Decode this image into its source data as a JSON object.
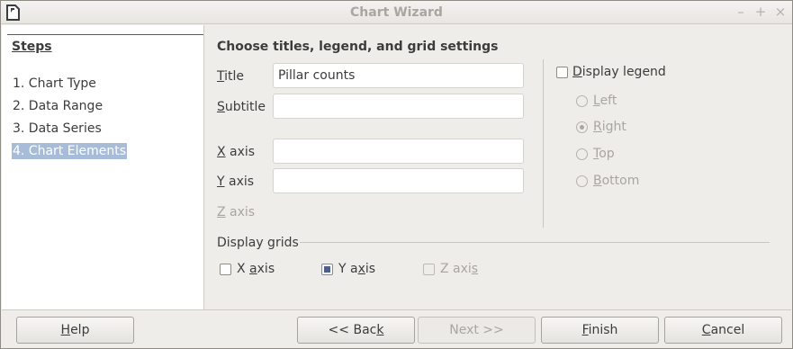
{
  "window": {
    "title": "Chart Wizard"
  },
  "wm": {
    "minimize": "–",
    "maximize": "+",
    "close": "×"
  },
  "steps": {
    "title": "Steps",
    "items": [
      {
        "label": "1. Chart Type",
        "active": false
      },
      {
        "label": "2. Data Range",
        "active": false
      },
      {
        "label": "3. Data Series",
        "active": false
      },
      {
        "label": "4. Chart Elements",
        "active": true
      }
    ]
  },
  "main": {
    "heading": "Choose titles, legend, and grid settings",
    "fields": {
      "title": {
        "label_key": "T",
        "label_rest": "itle",
        "value": "Pillar counts"
      },
      "subtitle": {
        "label_key": "S",
        "label_rest": "ubtitle",
        "value": ""
      },
      "x_axis": {
        "label_key": "X",
        "label_rest": " axis",
        "value": ""
      },
      "y_axis": {
        "label_key": "Y",
        "label_rest": " axis",
        "value": ""
      },
      "z_axis": {
        "label_key": "Z",
        "label_rest": " axis",
        "value": ""
      }
    },
    "legend": {
      "display_key": "D",
      "display_rest": "isplay legend",
      "display_checked": false,
      "positions": [
        {
          "key": "L",
          "rest": "eft",
          "selected": false
        },
        {
          "key": "R",
          "rest": "ight",
          "selected": true
        },
        {
          "key": "T",
          "rest": "op",
          "selected": false
        },
        {
          "key": "B",
          "rest": "ottom",
          "selected": false
        }
      ]
    },
    "grids": {
      "label": "Display grids",
      "x": {
        "pre": "X ",
        "key": "a",
        "rest": "xis",
        "checked": false
      },
      "y": {
        "pre": "Y a",
        "key": "x",
        "rest": "is",
        "checked": true
      },
      "z": {
        "pre": "Z axi",
        "key": "s",
        "rest": "",
        "checked": false
      }
    }
  },
  "buttons": {
    "help": {
      "key": "H",
      "rest": "elp"
    },
    "back": {
      "pre": "<< Bac",
      "key": "k",
      "rest": ""
    },
    "next": {
      "pre": "Next >>"
    },
    "finish": {
      "key": "F",
      "rest": "inish"
    },
    "cancel": {
      "key": "C",
      "rest": "ancel"
    }
  }
}
